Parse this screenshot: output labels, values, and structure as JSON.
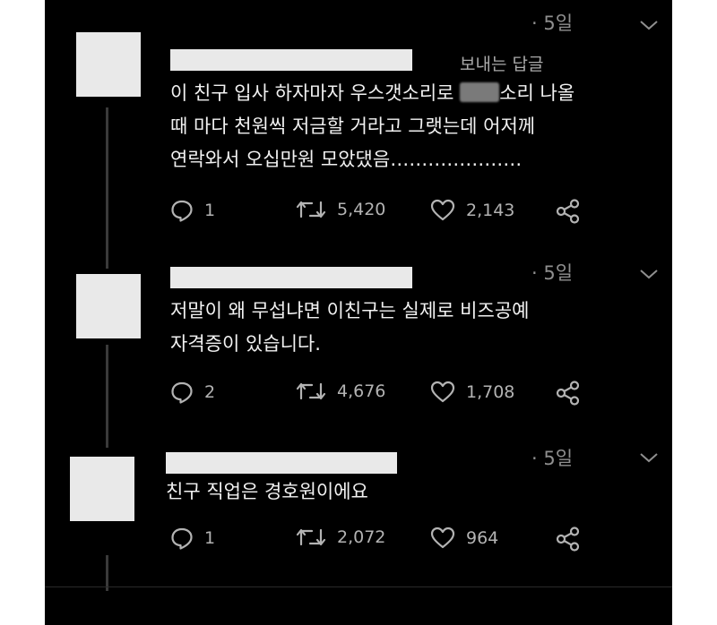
{
  "tweets": [
    {
      "time": "· 5일",
      "hint": "보내는 답글",
      "lines": [
        "이 친구 입사 하자마자 우스갯소리로 ",
        "소리 나올",
        "때 마다 천원씩 저금할 거라고 그랫는데 어저께",
        "연락와서 오십만원 모았댔음…………………"
      ],
      "replies": "1",
      "retweets": "5,420",
      "likes": "2,143"
    },
    {
      "time": "· 5일",
      "lines": [
        "저말이 왜 무섭냐면 이친구는 실제로 비즈공예",
        "자격증이 있습니다."
      ],
      "replies": "2",
      "retweets": "4,676",
      "likes": "1,708"
    },
    {
      "time": "· 5일",
      "lines": [
        "친구 직업은 경호원이에요"
      ],
      "replies": "1",
      "retweets": "2,072",
      "likes": "964"
    }
  ],
  "colors": {
    "background": "#000000",
    "text": "#f2f2f2",
    "muted": "#8f8f8f",
    "placeholder": "#e9e9e9"
  },
  "icons": [
    "reply-icon",
    "retweet-icon",
    "like-icon",
    "share-icon",
    "chevron-down-icon"
  ]
}
